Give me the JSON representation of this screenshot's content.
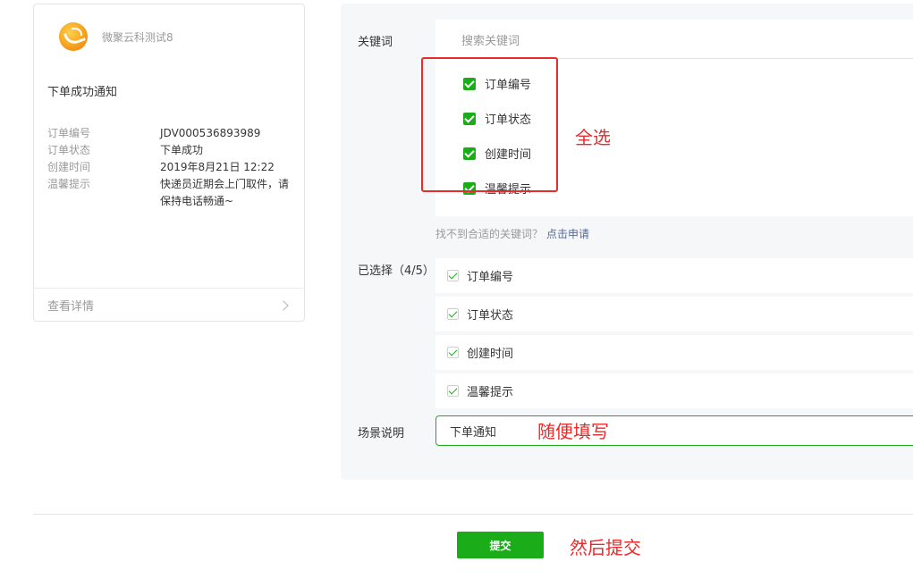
{
  "preview": {
    "account_name": "微聚云科测试8",
    "template_title": "下单成功通知",
    "fields": [
      {
        "key": "订单编号",
        "value": "JDV000536893989"
      },
      {
        "key": "订单状态",
        "value": "下单成功"
      },
      {
        "key": "创建时间",
        "value": "2019年8月21日 12:22"
      },
      {
        "key": "温馨提示",
        "value": "快递员近期会上门取件，请保持电话畅通~"
      }
    ],
    "footer_label": "查看详情"
  },
  "form": {
    "keyword_label": "关键词",
    "search_placeholder": "搜索关键词",
    "keywords": [
      "订单编号",
      "订单状态",
      "创建时间",
      "温馨提示"
    ],
    "hint_text": "找不到合适的关键词？",
    "hint_link": "点击申请",
    "selected_label": "已选择（4/5）",
    "selected": [
      "订单编号",
      "订单状态",
      "创建时间",
      "温馨提示"
    ],
    "scene_label": "场景说明",
    "scene_value": "下单通知",
    "submit_label": "提交"
  },
  "annotations": {
    "select_all": "全选",
    "fill_any": "随便填写",
    "then_submit": "然后提交"
  },
  "colors": {
    "accent_green": "#1aad19",
    "annotation_red": "#e62c2c",
    "link_blue": "#576b95",
    "panel_bg": "#f6f7f9"
  }
}
